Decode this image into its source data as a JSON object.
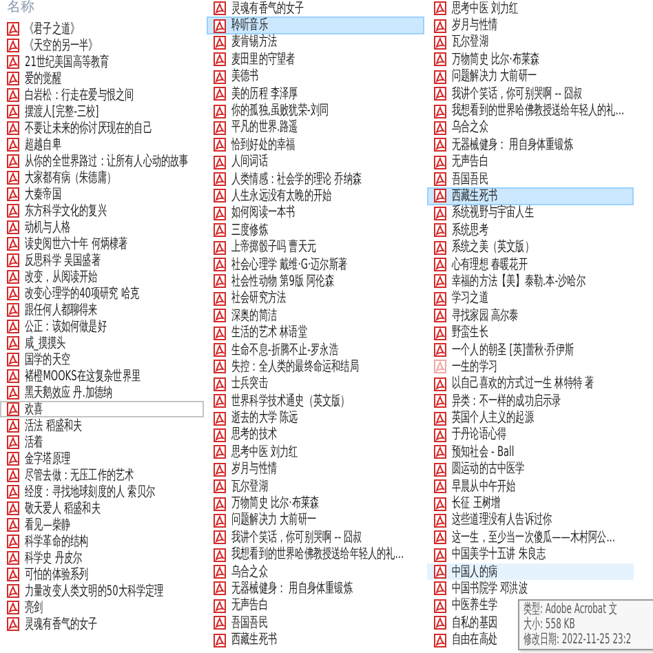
{
  "header": {
    "label": "名称"
  },
  "columns": [
    {
      "items": [
        {
          "name": "《君子之道》",
          "kind": "pdf",
          "selected": false,
          "focused": false,
          "hovered": false
        },
        {
          "name": "《天空的另一半》",
          "kind": "pdf",
          "selected": false,
          "focused": false,
          "hovered": false
        },
        {
          "name": "21世纪美国高等教育",
          "kind": "pdf",
          "selected": false,
          "focused": false,
          "hovered": false
        },
        {
          "name": "爱的觉醒",
          "kind": "pdf",
          "selected": false,
          "focused": false,
          "hovered": false
        },
        {
          "name": "白岩松：行走在爱与恨之间",
          "kind": "pdf",
          "selected": false,
          "focused": false,
          "hovered": false
        },
        {
          "name": "摆渡人[完整-三校]",
          "kind": "pdf",
          "selected": false,
          "focused": false,
          "hovered": false
        },
        {
          "name": "不要让未来的你讨厌现在的自己",
          "kind": "pdf",
          "selected": false,
          "focused": false,
          "hovered": false
        },
        {
          "name": "超越自卑",
          "kind": "pdf",
          "selected": false,
          "focused": false,
          "hovered": false
        },
        {
          "name": "从你的全世界路过：让所有人心动的故事",
          "kind": "pdf",
          "selected": false,
          "focused": false,
          "hovered": false
        },
        {
          "name": "大家都有病（朱德庸）",
          "kind": "pdf",
          "selected": false,
          "focused": false,
          "hovered": false
        },
        {
          "name": "大秦帝国",
          "kind": "pdf",
          "selected": false,
          "focused": false,
          "hovered": false
        },
        {
          "name": "东方科学文化的复兴",
          "kind": "pdf",
          "selected": false,
          "focused": false,
          "hovered": false
        },
        {
          "name": "动机与人格",
          "kind": "pdf",
          "selected": false,
          "focused": false,
          "hovered": false
        },
        {
          "name": "读史阅世六十年 何炳棣著",
          "kind": "pdf",
          "selected": false,
          "focused": false,
          "hovered": false
        },
        {
          "name": "反思科学 吴国盛著",
          "kind": "pdf",
          "selected": false,
          "focused": false,
          "hovered": false
        },
        {
          "name": "改变，从阅读开始",
          "kind": "pdf",
          "selected": false,
          "focused": false,
          "hovered": false
        },
        {
          "name": "改变心理学的40项研究 哈克",
          "kind": "pdf",
          "selected": false,
          "focused": false,
          "hovered": false
        },
        {
          "name": "跟任何人都聊得来",
          "kind": "pdf",
          "selected": false,
          "focused": false,
          "hovered": false
        },
        {
          "name": "公正：该如何做是好",
          "kind": "pdf",
          "selected": false,
          "focused": false,
          "hovered": false
        },
        {
          "name": "咸_摸摸头",
          "kind": "pdf",
          "selected": false,
          "focused": false,
          "hovered": false
        },
        {
          "name": "国学的天空",
          "kind": "pdf",
          "selected": false,
          "focused": false,
          "hovered": false
        },
        {
          "name": "褚橙MOOKS在这复杂世界里",
          "kind": "pdf",
          "selected": false,
          "focused": false,
          "hovered": false
        },
        {
          "name": "黑天鹅效应 丹.加德纳",
          "kind": "pdf",
          "selected": false,
          "focused": false,
          "hovered": false
        },
        {
          "name": "欢喜",
          "kind": "pdf",
          "selected": false,
          "focused": true,
          "hovered": false
        },
        {
          "name": "活法 稻盛和夫",
          "kind": "pdf",
          "selected": false,
          "focused": false,
          "hovered": false
        },
        {
          "name": "活着",
          "kind": "pdf",
          "selected": false,
          "focused": false,
          "hovered": false
        },
        {
          "name": "金字塔原理",
          "kind": "pdf",
          "selected": false,
          "focused": false,
          "hovered": false
        },
        {
          "name": "尽管去做：无压工作的艺术",
          "kind": "pdf",
          "selected": false,
          "focused": false,
          "hovered": false
        },
        {
          "name": "经度：寻找地球刻度的人 索贝尔",
          "kind": "pdf",
          "selected": false,
          "focused": false,
          "hovered": false
        },
        {
          "name": "敬天爱人 稻盛和夫",
          "kind": "pdf",
          "selected": false,
          "focused": false,
          "hovered": false
        },
        {
          "name": "看见—柴静",
          "kind": "pdf",
          "selected": false,
          "focused": false,
          "hovered": false
        },
        {
          "name": "科学革命的结构",
          "kind": "pdf",
          "selected": false,
          "focused": false,
          "hovered": false
        },
        {
          "name": "科学史 丹皮尔",
          "kind": "pdf",
          "selected": false,
          "focused": false,
          "hovered": false
        },
        {
          "name": "可怕的体验系列",
          "kind": "pdf",
          "selected": false,
          "focused": false,
          "hovered": false
        },
        {
          "name": "力量改变人类文明的50大科学定理",
          "kind": "pdf",
          "selected": false,
          "focused": false,
          "hovered": false
        },
        {
          "name": "亮剑",
          "kind": "pdf",
          "selected": false,
          "focused": false,
          "hovered": false
        },
        {
          "name": "灵魂有香气的女子",
          "kind": "pdf",
          "selected": false,
          "focused": false,
          "hovered": false
        }
      ]
    },
    {
      "items": [
        {
          "name": "灵魂有香气的女子",
          "kind": "pdf",
          "selected": false,
          "focused": false,
          "hovered": false
        },
        {
          "name": "聆听音乐",
          "kind": "pdf",
          "selected": true,
          "focused": false,
          "hovered": false
        },
        {
          "name": "麦肯锡方法",
          "kind": "pdf",
          "selected": false,
          "focused": false,
          "hovered": false
        },
        {
          "name": "麦田里的守望者",
          "kind": "pdf",
          "selected": false,
          "focused": false,
          "hovered": false
        },
        {
          "name": "美德书",
          "kind": "pdf",
          "selected": false,
          "focused": false,
          "hovered": false
        },
        {
          "name": "美的历程 李泽厚",
          "kind": "pdf",
          "selected": false,
          "focused": false,
          "hovered": false
        },
        {
          "name": "你的孤独,虽败犹荣-刘同",
          "kind": "pdf",
          "selected": false,
          "focused": false,
          "hovered": false
        },
        {
          "name": "平凡的世界.路遥",
          "kind": "pdf",
          "selected": false,
          "focused": false,
          "hovered": false
        },
        {
          "name": "恰到好处的幸福",
          "kind": "pdf",
          "selected": false,
          "focused": false,
          "hovered": false
        },
        {
          "name": "人间词话",
          "kind": "pdf",
          "selected": false,
          "focused": false,
          "hovered": false
        },
        {
          "name": "人类情感：社会学的理论 乔纳森",
          "kind": "pdf",
          "selected": false,
          "focused": false,
          "hovered": false
        },
        {
          "name": "人生永远没有太晚的开始",
          "kind": "pdf",
          "selected": false,
          "focused": false,
          "hovered": false
        },
        {
          "name": "如何阅读一本书",
          "kind": "pdf",
          "selected": false,
          "focused": false,
          "hovered": false
        },
        {
          "name": "三度修炼",
          "kind": "pdf",
          "selected": false,
          "focused": false,
          "hovered": false
        },
        {
          "name": "上帝掷骰子吗 曹天元",
          "kind": "pdf",
          "selected": false,
          "focused": false,
          "hovered": false
        },
        {
          "name": "社会心理学 戴维·G·迈尔斯著",
          "kind": "pdf",
          "selected": false,
          "focused": false,
          "hovered": false
        },
        {
          "name": "社会性动物 第9版 阿伦森",
          "kind": "pdf",
          "selected": false,
          "focused": false,
          "hovered": false
        },
        {
          "name": "社会研究方法",
          "kind": "pdf",
          "selected": false,
          "focused": false,
          "hovered": false
        },
        {
          "name": "深奥的简洁",
          "kind": "pdf",
          "selected": false,
          "focused": false,
          "hovered": false
        },
        {
          "name": "生活的艺术 林语堂",
          "kind": "pdf",
          "selected": false,
          "focused": false,
          "hovered": false
        },
        {
          "name": "生命不息-折腾不止-罗永浩",
          "kind": "pdf",
          "selected": false,
          "focused": false,
          "hovered": false
        },
        {
          "name": "失控：全人类的最终命运和结局",
          "kind": "pdf",
          "selected": false,
          "focused": false,
          "hovered": false
        },
        {
          "name": "士兵突击",
          "kind": "pdf",
          "selected": false,
          "focused": false,
          "hovered": false
        },
        {
          "name": "世界科学技术通史（英文版）",
          "kind": "pdf",
          "selected": false,
          "focused": false,
          "hovered": false
        },
        {
          "name": "逝去的大学 陈远",
          "kind": "pdf",
          "selected": false,
          "focused": false,
          "hovered": false
        },
        {
          "name": "思考的技术",
          "kind": "pdf",
          "selected": false,
          "focused": false,
          "hovered": false
        },
        {
          "name": "思考中医 刘力红",
          "kind": "pdf",
          "selected": false,
          "focused": false,
          "hovered": false
        },
        {
          "name": "岁月与性情",
          "kind": "pdf",
          "selected": false,
          "focused": false,
          "hovered": false
        },
        {
          "name": "瓦尔登湖",
          "kind": "pdf",
          "selected": false,
          "focused": false,
          "hovered": false
        },
        {
          "name": "万物简史 比尔·布莱森",
          "kind": "pdf",
          "selected": false,
          "focused": false,
          "hovered": false
        },
        {
          "name": "问题解决力 大前研一",
          "kind": "pdf",
          "selected": false,
          "focused": false,
          "hovered": false
        },
        {
          "name": "我讲个笑话，你可别哭啊 -- 囧叔",
          "kind": "pdf",
          "selected": false,
          "focused": false,
          "hovered": false
        },
        {
          "name": "我想看到的世界哈佛教授送给年轻人的礼...",
          "kind": "pdf",
          "selected": false,
          "focused": false,
          "hovered": false
        },
        {
          "name": "乌合之众",
          "kind": "pdf",
          "selected": false,
          "focused": false,
          "hovered": false
        },
        {
          "name": "无器械健身：  用自身体重锻炼",
          "kind": "pdf",
          "selected": false,
          "focused": false,
          "hovered": false
        },
        {
          "name": "无声告白",
          "kind": "pdf",
          "selected": false,
          "focused": false,
          "hovered": false
        },
        {
          "name": "吾国吾民",
          "kind": "pdf",
          "selected": false,
          "focused": false,
          "hovered": false
        },
        {
          "name": "西藏生死书",
          "kind": "pdf",
          "selected": false,
          "focused": false,
          "hovered": false
        }
      ]
    },
    {
      "items": [
        {
          "name": "思考中医 刘力红",
          "kind": "pdf",
          "selected": false,
          "focused": false,
          "hovered": false
        },
        {
          "name": "岁月与性情",
          "kind": "pdf",
          "selected": false,
          "focused": false,
          "hovered": false
        },
        {
          "name": "瓦尔登湖",
          "kind": "pdf",
          "selected": false,
          "focused": false,
          "hovered": false
        },
        {
          "name": "万物简史 比尔·布莱森",
          "kind": "pdf",
          "selected": false,
          "focused": false,
          "hovered": false
        },
        {
          "name": "问题解决力 大前研一",
          "kind": "pdf",
          "selected": false,
          "focused": false,
          "hovered": false
        },
        {
          "name": "我讲个笑话，你可别哭啊 -- 囧叔",
          "kind": "pdf",
          "selected": false,
          "focused": false,
          "hovered": false
        },
        {
          "name": "我想看到的世界哈佛教授送给年轻人的礼...",
          "kind": "pdf",
          "selected": false,
          "focused": false,
          "hovered": false
        },
        {
          "name": "乌合之众",
          "kind": "pdf",
          "selected": false,
          "focused": false,
          "hovered": false
        },
        {
          "name": "无器械健身：  用自身体重锻炼",
          "kind": "pdf",
          "selected": false,
          "focused": false,
          "hovered": false
        },
        {
          "name": "无声告白",
          "kind": "pdf",
          "selected": false,
          "focused": false,
          "hovered": false
        },
        {
          "name": "吾国吾民",
          "kind": "pdf",
          "selected": false,
          "focused": false,
          "hovered": false
        },
        {
          "name": "西藏生死书",
          "kind": "pdf",
          "selected": true,
          "focused": false,
          "hovered": false
        },
        {
          "name": "系统视野与宇宙人生",
          "kind": "pdf",
          "selected": false,
          "focused": false,
          "hovered": false
        },
        {
          "name": "系统思考",
          "kind": "pdf",
          "selected": false,
          "focused": false,
          "hovered": false
        },
        {
          "name": "系统之美（英文版）",
          "kind": "pdf",
          "selected": false,
          "focused": false,
          "hovered": false
        },
        {
          "name": "心有理想 春暖花开",
          "kind": "pdf",
          "selected": false,
          "focused": false,
          "hovered": false
        },
        {
          "name": "幸福的方法【美】泰勒.本-沙哈尔",
          "kind": "pdf",
          "selected": false,
          "focused": false,
          "hovered": false
        },
        {
          "name": "学习之道",
          "kind": "pdf",
          "selected": false,
          "focused": false,
          "hovered": false
        },
        {
          "name": "寻找家园 高尔泰",
          "kind": "pdf",
          "selected": false,
          "focused": false,
          "hovered": false
        },
        {
          "name": "野蛮生长",
          "kind": "pdf",
          "selected": false,
          "focused": false,
          "hovered": false
        },
        {
          "name": "一个人的朝圣 [英]蕾秋·乔伊斯",
          "kind": "pdf",
          "selected": false,
          "focused": false,
          "hovered": false
        },
        {
          "name": "一生的学习",
          "kind": "faded",
          "selected": false,
          "focused": false,
          "hovered": false
        },
        {
          "name": "以自己喜欢的方式过一生 林特特 著",
          "kind": "pdf",
          "selected": false,
          "focused": false,
          "hovered": false
        },
        {
          "name": "异类：不一样的成功启示录",
          "kind": "pdf",
          "selected": false,
          "focused": false,
          "hovered": false
        },
        {
          "name": "英国个人主义的起源",
          "kind": "pdf",
          "selected": false,
          "focused": false,
          "hovered": false
        },
        {
          "name": "于丹论语心得",
          "kind": "pdf",
          "selected": false,
          "focused": false,
          "hovered": false
        },
        {
          "name": "预知社会 - Ball",
          "kind": "pdf",
          "selected": false,
          "focused": false,
          "hovered": false
        },
        {
          "name": "圆运动的古中医学",
          "kind": "pdf",
          "selected": false,
          "focused": false,
          "hovered": false
        },
        {
          "name": "早晨从中午开始",
          "kind": "pdf",
          "selected": false,
          "focused": false,
          "hovered": false
        },
        {
          "name": "长征 王树增",
          "kind": "pdf",
          "selected": false,
          "focused": false,
          "hovered": false
        },
        {
          "name": "这些道理没有人告诉过你",
          "kind": "pdf",
          "selected": false,
          "focused": false,
          "hovered": false
        },
        {
          "name": "这一生，至少当一次傻瓜——木村阿公...",
          "kind": "pdf",
          "selected": false,
          "focused": false,
          "hovered": false
        },
        {
          "name": "中国美学十五讲 朱良志",
          "kind": "pdf",
          "selected": false,
          "focused": false,
          "hovered": false
        },
        {
          "name": "中国人的病",
          "kind": "pdf",
          "selected": false,
          "focused": false,
          "hovered": true
        },
        {
          "name": "中国书院学 邓洪波",
          "kind": "pdf",
          "selected": false,
          "focused": false,
          "hovered": false
        },
        {
          "name": "中医养生学",
          "kind": "pdf",
          "selected": false,
          "focused": false,
          "hovered": false
        },
        {
          "name": "自私的基因",
          "kind": "pdf",
          "selected": false,
          "focused": false,
          "hovered": false
        },
        {
          "name": "自由在高处",
          "kind": "pdf",
          "selected": false,
          "focused": false,
          "hovered": false
        }
      ]
    }
  ],
  "tooltip": {
    "lines": [
      "类型: Adobe Acrobat 文",
      "大小: 558 KB",
      "修改日期: 2022-11-25 23:2"
    ]
  }
}
